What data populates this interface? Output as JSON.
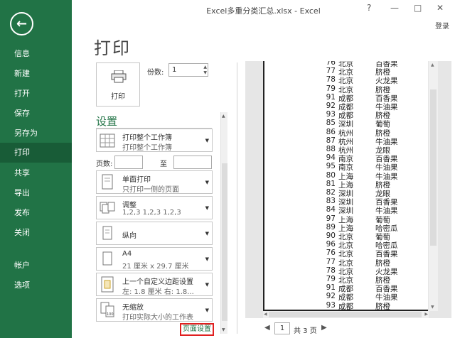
{
  "window": {
    "title": "Excel多重分类汇总.xlsx - Excel",
    "help_label": "?",
    "minimize_label": "—",
    "restore_label": "□",
    "close_label": "✕",
    "login_label": "登录"
  },
  "sidebar": {
    "items": [
      {
        "label": "信息"
      },
      {
        "label": "新建"
      },
      {
        "label": "打开"
      },
      {
        "label": "保存"
      },
      {
        "label": "另存为"
      },
      {
        "label": "打印"
      },
      {
        "label": "共享"
      },
      {
        "label": "导出"
      },
      {
        "label": "发布"
      },
      {
        "label": "关闭"
      },
      {
        "label": "帐户"
      },
      {
        "label": "选项"
      }
    ],
    "active": "打印"
  },
  "main": {
    "title": "打印",
    "print_button_label": "打印",
    "copies_label": "份数:",
    "copies_value": "1",
    "settings_title": "设置",
    "settings": [
      {
        "main": "打印整个工作簿",
        "sub": "打印整个工作簿"
      },
      {
        "main": "单面打印",
        "sub": "只打印一侧的页面"
      },
      {
        "main": "调整",
        "sub": "1,2,3    1,2,3    1,2,3"
      },
      {
        "main": "纵向",
        "sub": ""
      },
      {
        "main": "A4",
        "sub": "21 厘米 x 29.7 厘米"
      },
      {
        "main": "上一个自定义边距设置",
        "sub": "左: 1.8 厘米   右: 1.8..."
      },
      {
        "main": "无缩放",
        "sub": "打印实际大小的工作表"
      }
    ],
    "pages_label": "页数:",
    "pages_to_label": "至",
    "page_setup_link": "页面设置"
  },
  "preview": {
    "rows": [
      {
        "n": "76",
        "city": "北京",
        "fruit": "百香果"
      },
      {
        "n": "77",
        "city": "北京",
        "fruit": "脐橙"
      },
      {
        "n": "78",
        "city": "北京",
        "fruit": "火龙果"
      },
      {
        "n": "79",
        "city": "北京",
        "fruit": "脐橙"
      },
      {
        "n": "91",
        "city": "成都",
        "fruit": "百香果"
      },
      {
        "n": "92",
        "city": "成都",
        "fruit": "牛油果"
      },
      {
        "n": "93",
        "city": "成都",
        "fruit": "脐橙"
      },
      {
        "n": "85",
        "city": "深圳",
        "fruit": "葡萄"
      },
      {
        "n": "86",
        "city": "杭州",
        "fruit": "脐橙"
      },
      {
        "n": "87",
        "city": "杭州",
        "fruit": "牛油果"
      },
      {
        "n": "88",
        "city": "杭州",
        "fruit": "龙眼"
      },
      {
        "n": "94",
        "city": "南京",
        "fruit": "百香果"
      },
      {
        "n": "95",
        "city": "南京",
        "fruit": "牛油果"
      },
      {
        "n": "80",
        "city": "上海",
        "fruit": "牛油果"
      },
      {
        "n": "81",
        "city": "上海",
        "fruit": "脐橙"
      },
      {
        "n": "82",
        "city": "深圳",
        "fruit": "龙眼"
      },
      {
        "n": "83",
        "city": "深圳",
        "fruit": "百香果"
      },
      {
        "n": "84",
        "city": "深圳",
        "fruit": "牛油果"
      },
      {
        "n": "97",
        "city": "上海",
        "fruit": "葡萄"
      },
      {
        "n": "89",
        "city": "上海",
        "fruit": "哈密瓜"
      },
      {
        "n": "90",
        "city": "北京",
        "fruit": "葡萄"
      },
      {
        "n": "96",
        "city": "北京",
        "fruit": "哈密瓜"
      },
      {
        "n": "76",
        "city": "北京",
        "fruit": "百香果"
      },
      {
        "n": "77",
        "city": "北京",
        "fruit": "脐橙"
      },
      {
        "n": "78",
        "city": "北京",
        "fruit": "火龙果"
      },
      {
        "n": "79",
        "city": "北京",
        "fruit": "脐橙"
      },
      {
        "n": "91",
        "city": "成都",
        "fruit": "百香果"
      },
      {
        "n": "92",
        "city": "成都",
        "fruit": "牛油果"
      },
      {
        "n": "93",
        "city": "成都",
        "fruit": "脐橙"
      }
    ],
    "current_page": "1",
    "total_pages_label": "共 3 页"
  },
  "colors": {
    "sidebar_bg": "#217346",
    "sidebar_active": "#185c37",
    "accent": "#217346",
    "highlight_border": "#e02020"
  }
}
